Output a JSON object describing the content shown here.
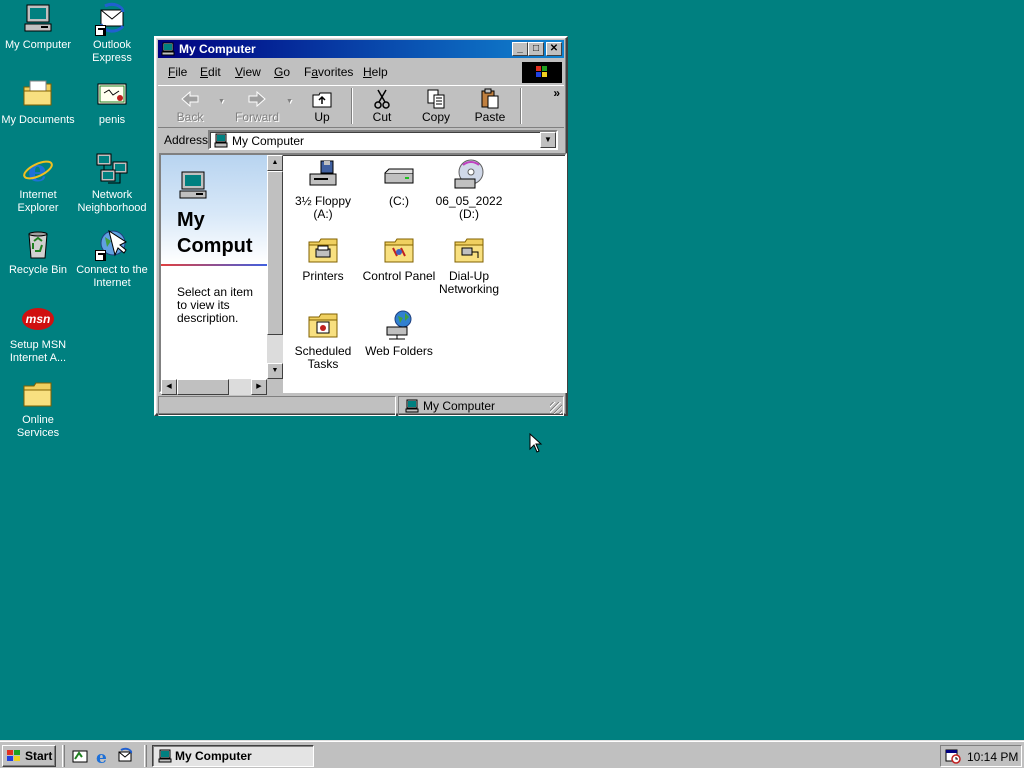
{
  "desktop": {
    "icons": [
      {
        "label": "My Computer"
      },
      {
        "label": "Outlook Express"
      },
      {
        "label": "My Documents"
      },
      {
        "label": "penis"
      },
      {
        "label": "Internet Explorer"
      },
      {
        "label": "Network Neighborhood"
      },
      {
        "label": "Recycle Bin"
      },
      {
        "label": "Connect to the Internet"
      },
      {
        "label": "Setup MSN Internet A..."
      },
      {
        "label": "Online Services"
      }
    ],
    "msn_logo_text": "msn",
    "background_color": "#008080"
  },
  "window": {
    "title": "My Computer",
    "title_buttons": {
      "minimize": "_",
      "maximize": "□",
      "close": "✕"
    },
    "menu": [
      {
        "label": "File",
        "accel": "F",
        "rest": "ile"
      },
      {
        "label": "Edit",
        "accel": "E",
        "rest": "dit"
      },
      {
        "label": "View",
        "accel": "V",
        "rest": "iew"
      },
      {
        "label": "Go",
        "accel": "G",
        "rest": "o"
      },
      {
        "label": "Favorites",
        "accel": "a",
        "pre": "F",
        "rest": "vorites"
      },
      {
        "label": "Help",
        "accel": "H",
        "rest": "elp"
      }
    ],
    "toolbar": {
      "back": "Back",
      "forward": "Forward",
      "up": "Up",
      "cut": "Cut",
      "copy": "Copy",
      "paste": "Paste",
      "more": "»"
    },
    "address": {
      "label": "Address",
      "value": "My Computer"
    },
    "left_pane": {
      "heading": "My\nComput",
      "description": "Select an item to view its description."
    },
    "items": [
      {
        "label": "3½ Floppy (A:)",
        "icon": "floppy-drive-icon"
      },
      {
        "label": "(C:)",
        "icon": "hard-drive-icon"
      },
      {
        "label": "06_05_2022 (D:)",
        "icon": "cd-drive-icon"
      },
      {
        "label": "Printers",
        "icon": "printers-folder-icon"
      },
      {
        "label": "Control Panel",
        "icon": "control-panel-folder-icon"
      },
      {
        "label": "Dial-Up Networking",
        "icon": "dialup-folder-icon"
      },
      {
        "label": "Scheduled Tasks",
        "icon": "scheduled-tasks-folder-icon"
      },
      {
        "label": "Web Folders",
        "icon": "web-folders-icon"
      }
    ],
    "status": {
      "location": "My Computer"
    }
  },
  "taskbar": {
    "start_label": "Start",
    "task_button": "My Computer",
    "clock": "10:14 PM"
  },
  "colors": {
    "title_active_start": "#000080",
    "title_active_end": "#1084d0",
    "face": "#c0c0c0"
  }
}
